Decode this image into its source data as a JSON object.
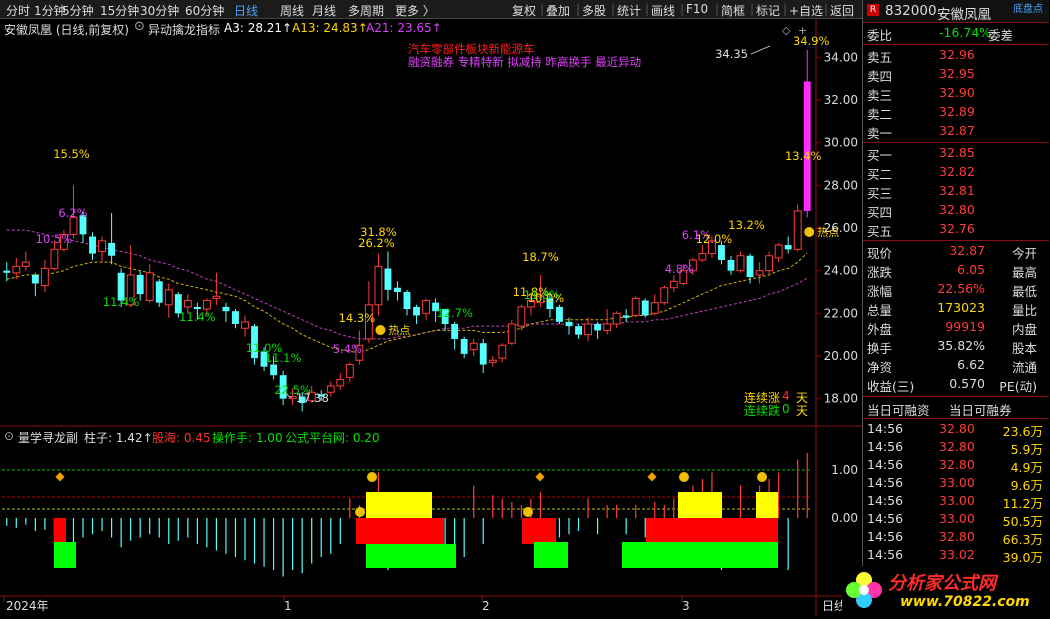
{
  "toolbar": {
    "items": [
      "分时",
      "1分钟",
      "5分钟",
      "15分钟",
      "30分钟",
      "60分钟",
      "日线",
      "周线",
      "月线",
      "多周期",
      "更多 〉"
    ],
    "active": "日线",
    "buttons": [
      "复权",
      "叠加",
      "多股",
      "统计",
      "画线",
      "F10",
      "简框",
      "标记",
      "+自选",
      "返回"
    ]
  },
  "main": {
    "title": "安徽凤凰 (日线,前复权)",
    "indicator_name": "异动擒龙指标",
    "a3": "A3: 28.21↑",
    "a13": "A13: 24.83↑",
    "a21": "A21: 23.65↑",
    "news_red": "汽车零部件板块新能源车",
    "news_tags": "融资融券 专精特新 拟减持 昨高换手 最近异动",
    "pct_labels": [
      "15.5%",
      "6.2%",
      "10.5%",
      "11.4%",
      "11.4%",
      "11.0%",
      "11.1%",
      "22.5%",
      "31.8%",
      "26.2%",
      "14.3%",
      "5.4%",
      "12.7%",
      "11.8%",
      "18.7%",
      "11.8%",
      "10.0%",
      "4.8%",
      "6.1%",
      "12.0%",
      "13.2%",
      "13.4%",
      "34.9%"
    ],
    "hot_label": "热点",
    "high_label": "34.35",
    "low_label": "17.38",
    "streak_up_label": "连续涨",
    "streak_up_val": "4",
    "streak_down_label": "连续跌",
    "streak_down_val": "0",
    "day": "天",
    "yaxis": [
      "34.00",
      "32.00",
      "30.00",
      "28.00",
      "26.00",
      "24.00",
      "22.00",
      "20.00",
      "18.00"
    ]
  },
  "sub": {
    "title": "量学寻龙副",
    "zhuzi": "柱子: 1.42↑",
    "guhai": "股海: 0.45",
    "caozuo": "操作手: 1.00",
    "gongshi": "公式平台网: 0.20",
    "yaxis": [
      "1.00",
      "0.00"
    ]
  },
  "xaxis": {
    "labels": [
      "2024年",
      "1",
      "2",
      "3"
    ],
    "corner": "日线"
  },
  "right_panel": {
    "code": "832000",
    "name": "安徽凤凰",
    "tag": "底盘点",
    "weibi_label": "委比",
    "weibi": "-16.74%",
    "weicha_label": "委差",
    "asks": [
      {
        "label": "卖五",
        "price": "32.96"
      },
      {
        "label": "卖四",
        "price": "32.95"
      },
      {
        "label": "卖三",
        "price": "32.90"
      },
      {
        "label": "卖二",
        "price": "32.89"
      },
      {
        "label": "卖一",
        "price": "32.87"
      }
    ],
    "bids": [
      {
        "label": "买一",
        "price": "32.85"
      },
      {
        "label": "买二",
        "price": "32.82"
      },
      {
        "label": "买三",
        "price": "32.81"
      },
      {
        "label": "买四",
        "price": "32.80"
      },
      {
        "label": "买五",
        "price": "32.76"
      }
    ],
    "stats": [
      {
        "l": "现价",
        "v": "32.87",
        "r": "今开"
      },
      {
        "l": "涨跌",
        "v": "6.05",
        "r": "最高"
      },
      {
        "l": "涨幅",
        "v": "22.56%",
        "r": "最低"
      },
      {
        "l": "总量",
        "v": "173023",
        "r": "量比"
      },
      {
        "l": "外盘",
        "v": "99919",
        "r": "内盘"
      },
      {
        "l": "换手",
        "v": "35.82%",
        "r": "股本"
      },
      {
        "l": "净资",
        "v": "6.62",
        "r": "流通"
      },
      {
        "l": "收益(三)",
        "v": "0.570",
        "r": "PE(动)"
      }
    ],
    "margin_tabs": [
      "当日可融资",
      "当日可融券"
    ],
    "ticks": [
      {
        "t": "14:56",
        "p": "32.80",
        "v": "23.6万"
      },
      {
        "t": "14:56",
        "p": "32.80",
        "v": "5.9万"
      },
      {
        "t": "14:56",
        "p": "32.80",
        "v": "4.9万"
      },
      {
        "t": "14:56",
        "p": "33.00",
        "v": "9.6万"
      },
      {
        "t": "14:56",
        "p": "33.00",
        "v": "11.2万"
      },
      {
        "t": "14:56",
        "p": "33.00",
        "v": "50.5万"
      },
      {
        "t": "14:56",
        "p": "32.80",
        "v": "66.3万"
      },
      {
        "t": "14:56",
        "p": "33.02",
        "v": "39.0万"
      }
    ]
  },
  "watermark": {
    "text": "分析家公式网",
    "url": "www.70822.com"
  },
  "chart_data": {
    "type": "candlestick",
    "ylim": [
      17,
      35
    ],
    "candles": [
      [
        24.0,
        23.9,
        24.4,
        23.5
      ],
      [
        23.9,
        24.2,
        24.6,
        23.6
      ],
      [
        24.2,
        24.4,
        24.9,
        24.0
      ],
      [
        23.8,
        23.4,
        23.9,
        22.8
      ],
      [
        23.3,
        24.1,
        24.5,
        23.0
      ],
      [
        24.1,
        25.0,
        25.4,
        24.0
      ],
      [
        25.0,
        25.7,
        25.9,
        24.9
      ],
      [
        25.7,
        26.5,
        28.0,
        25.5
      ],
      [
        26.6,
        25.7,
        26.8,
        25.3
      ],
      [
        25.6,
        24.8,
        25.8,
        24.5
      ],
      [
        24.9,
        25.4,
        25.6,
        24.4
      ],
      [
        25.3,
        24.7,
        26.7,
        24.3
      ],
      [
        23.9,
        22.6,
        24.1,
        22.3
      ],
      [
        22.4,
        23.8,
        25.2,
        22.3
      ],
      [
        23.8,
        22.9,
        24.0,
        22.6
      ],
      [
        22.6,
        23.9,
        24.3,
        22.5
      ],
      [
        23.5,
        22.5,
        23.6,
        22.3
      ],
      [
        22.4,
        23.1,
        23.4,
        21.8
      ],
      [
        22.9,
        22.0,
        23.0,
        21.8
      ],
      [
        22.3,
        22.6,
        22.9,
        22.0
      ],
      [
        22.3,
        22.2,
        22.5,
        21.7
      ],
      [
        22.2,
        22.6,
        22.7,
        21.9
      ],
      [
        22.7,
        22.8,
        23.9,
        22.4
      ],
      [
        22.3,
        22.1,
        22.5,
        21.6
      ],
      [
        22.1,
        21.5,
        22.2,
        21.3
      ],
      [
        21.3,
        21.6,
        21.9,
        20.9
      ],
      [
        21.4,
        19.9,
        21.5,
        19.6
      ],
      [
        20.2,
        19.5,
        20.4,
        19.3
      ],
      [
        19.6,
        19.1,
        20.0,
        18.9
      ],
      [
        19.1,
        18.0,
        19.3,
        17.7
      ],
      [
        18.0,
        18.1,
        18.5,
        17.7
      ],
      [
        18.1,
        17.8,
        18.3,
        17.4
      ],
      [
        17.9,
        18.3,
        18.6,
        17.8
      ],
      [
        18.2,
        18.1,
        18.4,
        17.9
      ],
      [
        18.3,
        18.6,
        18.8,
        18.1
      ],
      [
        18.6,
        18.9,
        19.2,
        18.4
      ],
      [
        19.0,
        19.6,
        19.7,
        18.8
      ],
      [
        19.8,
        20.5,
        21.2,
        19.6
      ],
      [
        20.8,
        22.4,
        23.5,
        20.6
      ],
      [
        22.4,
        24.2,
        24.8,
        21.9
      ],
      [
        24.1,
        23.1,
        24.9,
        22.6
      ],
      [
        23.2,
        23.0,
        23.5,
        22.6
      ],
      [
        23.0,
        22.2,
        23.1,
        21.9
      ],
      [
        22.3,
        21.9,
        22.4,
        21.5
      ],
      [
        22.0,
        22.6,
        22.7,
        21.7
      ],
      [
        22.5,
        22.1,
        22.7,
        21.6
      ],
      [
        22.2,
        21.5,
        22.2,
        21.2
      ],
      [
        21.5,
        20.8,
        21.6,
        20.3
      ],
      [
        20.8,
        20.1,
        20.9,
        19.9
      ],
      [
        20.3,
        20.6,
        20.8,
        20.0
      ],
      [
        20.6,
        19.6,
        20.8,
        19.2
      ],
      [
        19.7,
        19.8,
        20.0,
        19.5
      ],
      [
        19.9,
        20.5,
        20.6,
        19.7
      ],
      [
        20.6,
        21.5,
        21.7,
        20.5
      ],
      [
        21.4,
        22.3,
        22.4,
        21.2
      ],
      [
        22.3,
        22.6,
        22.8,
        21.9
      ],
      [
        22.5,
        22.8,
        23.8,
        22.3
      ],
      [
        22.7,
        22.2,
        23.0,
        21.8
      ],
      [
        22.3,
        21.6,
        22.4,
        21.5
      ],
      [
        21.6,
        21.4,
        21.8,
        21.0
      ],
      [
        21.4,
        21.0,
        21.5,
        20.8
      ],
      [
        21.0,
        21.5,
        21.8,
        20.7
      ],
      [
        21.5,
        21.2,
        21.6,
        20.8
      ],
      [
        21.2,
        21.5,
        22.2,
        21.0
      ],
      [
        21.5,
        22.0,
        22.1,
        21.3
      ],
      [
        21.9,
        21.8,
        22.2,
        21.6
      ],
      [
        21.9,
        22.7,
        22.8,
        21.8
      ],
      [
        22.6,
        21.9,
        22.7,
        21.8
      ],
      [
        22.0,
        22.5,
        22.9,
        21.9
      ],
      [
        22.5,
        23.2,
        23.3,
        22.4
      ],
      [
        23.2,
        23.5,
        23.8,
        23.0
      ],
      [
        23.4,
        24.0,
        24.3,
        23.3
      ],
      [
        24.0,
        24.5,
        24.6,
        23.8
      ],
      [
        24.5,
        24.8,
        25.2,
        24.4
      ],
      [
        24.8,
        25.4,
        25.6,
        24.6
      ],
      [
        25.2,
        24.5,
        25.4,
        24.3
      ],
      [
        24.5,
        24.0,
        24.7,
        23.8
      ],
      [
        24.0,
        24.7,
        24.9,
        23.9
      ],
      [
        24.7,
        23.7,
        24.8,
        23.4
      ],
      [
        23.8,
        24.0,
        24.4,
        23.4
      ],
      [
        24.0,
        24.7,
        24.9,
        23.8
      ],
      [
        24.6,
        25.2,
        25.3,
        24.4
      ],
      [
        25.2,
        25.0,
        25.6,
        24.8
      ],
      [
        25.0,
        26.8,
        27.1,
        24.9
      ],
      [
        26.8,
        32.87,
        34.35,
        26.5
      ]
    ],
    "ma_yellow": [
      23.6,
      23.7,
      23.8,
      23.8,
      23.8,
      23.9,
      24.0,
      24.2,
      24.3,
      24.4,
      24.4,
      24.4,
      24.2,
      24.1,
      24.0,
      23.9,
      23.7,
      23.6,
      23.4,
      23.3,
      23.2,
      23.1,
      23.0,
      22.9,
      22.8,
      22.6,
      22.3,
      22.1,
      21.8,
      21.5,
      21.3,
      21.0,
      20.8,
      20.6,
      20.4,
      20.3,
      20.2,
      20.2,
      20.3,
      20.5,
      20.7,
      20.8,
      20.9,
      21.0,
      21.1,
      21.2,
      21.2,
      21.2,
      21.2,
      21.2,
      21.1,
      21.1,
      21.1,
      21.2,
      21.3,
      21.5,
      21.6,
      21.7,
      21.7,
      21.7,
      21.7,
      21.7,
      21.7,
      21.7,
      21.8,
      21.8,
      21.9,
      21.9,
      22.0,
      22.1,
      22.3,
      22.5,
      22.7,
      22.9,
      23.1,
      23.3,
      23.4,
      23.5,
      23.6,
      23.7,
      23.8,
      24.0,
      24.1,
      24.4,
      24.83
    ],
    "ma_purple": [
      25.9,
      25.9,
      25.9,
      25.8,
      25.7,
      25.6,
      25.5,
      25.4,
      25.3,
      25.2,
      25.1,
      25.0,
      24.9,
      24.8,
      24.7,
      24.5,
      24.4,
      24.3,
      24.1,
      24.0,
      23.8,
      23.6,
      23.5,
      23.3,
      23.1,
      22.9,
      22.7,
      22.5,
      22.3,
      22.1,
      21.9,
      21.7,
      21.5,
      21.3,
      21.2,
      21.0,
      20.9,
      20.8,
      20.8,
      20.8,
      20.8,
      20.9,
      20.9,
      21.0,
      21.1,
      21.2,
      21.3,
      21.3,
      21.3,
      21.4,
      21.4,
      21.4,
      21.4,
      21.4,
      21.5,
      21.5,
      21.5,
      21.5,
      21.5,
      21.5,
      21.5,
      21.5,
      21.5,
      21.5,
      21.5,
      21.6,
      21.6,
      21.6,
      21.7,
      21.7,
      21.8,
      21.9,
      22.0,
      22.1,
      22.2,
      22.3,
      22.4,
      22.5,
      22.6,
      22.7,
      22.9,
      23.0,
      23.2,
      23.4,
      23.65
    ],
    "volume": [
      0.12,
      0.15,
      0.1,
      0.2,
      0.18,
      0.3,
      0.35,
      0.4,
      0.3,
      0.25,
      0.2,
      0.3,
      0.45,
      0.35,
      0.3,
      0.25,
      0.3,
      0.4,
      0.35,
      0.3,
      0.4,
      0.45,
      0.5,
      0.55,
      0.6,
      0.65,
      0.7,
      0.75,
      0.8,
      0.9,
      0.8,
      0.85,
      0.7,
      0.6,
      0.55,
      0.4,
      0.3,
      0.2,
      0.3,
      0.7,
      0.8,
      0.6,
      0.5,
      0.4,
      0.35,
      0.4,
      0.5,
      0.55,
      0.6,
      0.5,
      0.4,
      0.35,
      0.3,
      0.25,
      0.2,
      0.3,
      0.4,
      0.35,
      0.3,
      0.25,
      0.2,
      0.3,
      0.25,
      0.2,
      0.2,
      0.25,
      0.2,
      0.3,
      0.25,
      0.2,
      0.3,
      0.4,
      0.5,
      0.6,
      0.7,
      0.8,
      0.6,
      0.5,
      0.4,
      0.5,
      0.6,
      0.7,
      0.8,
      0.9,
      1.0
    ]
  }
}
